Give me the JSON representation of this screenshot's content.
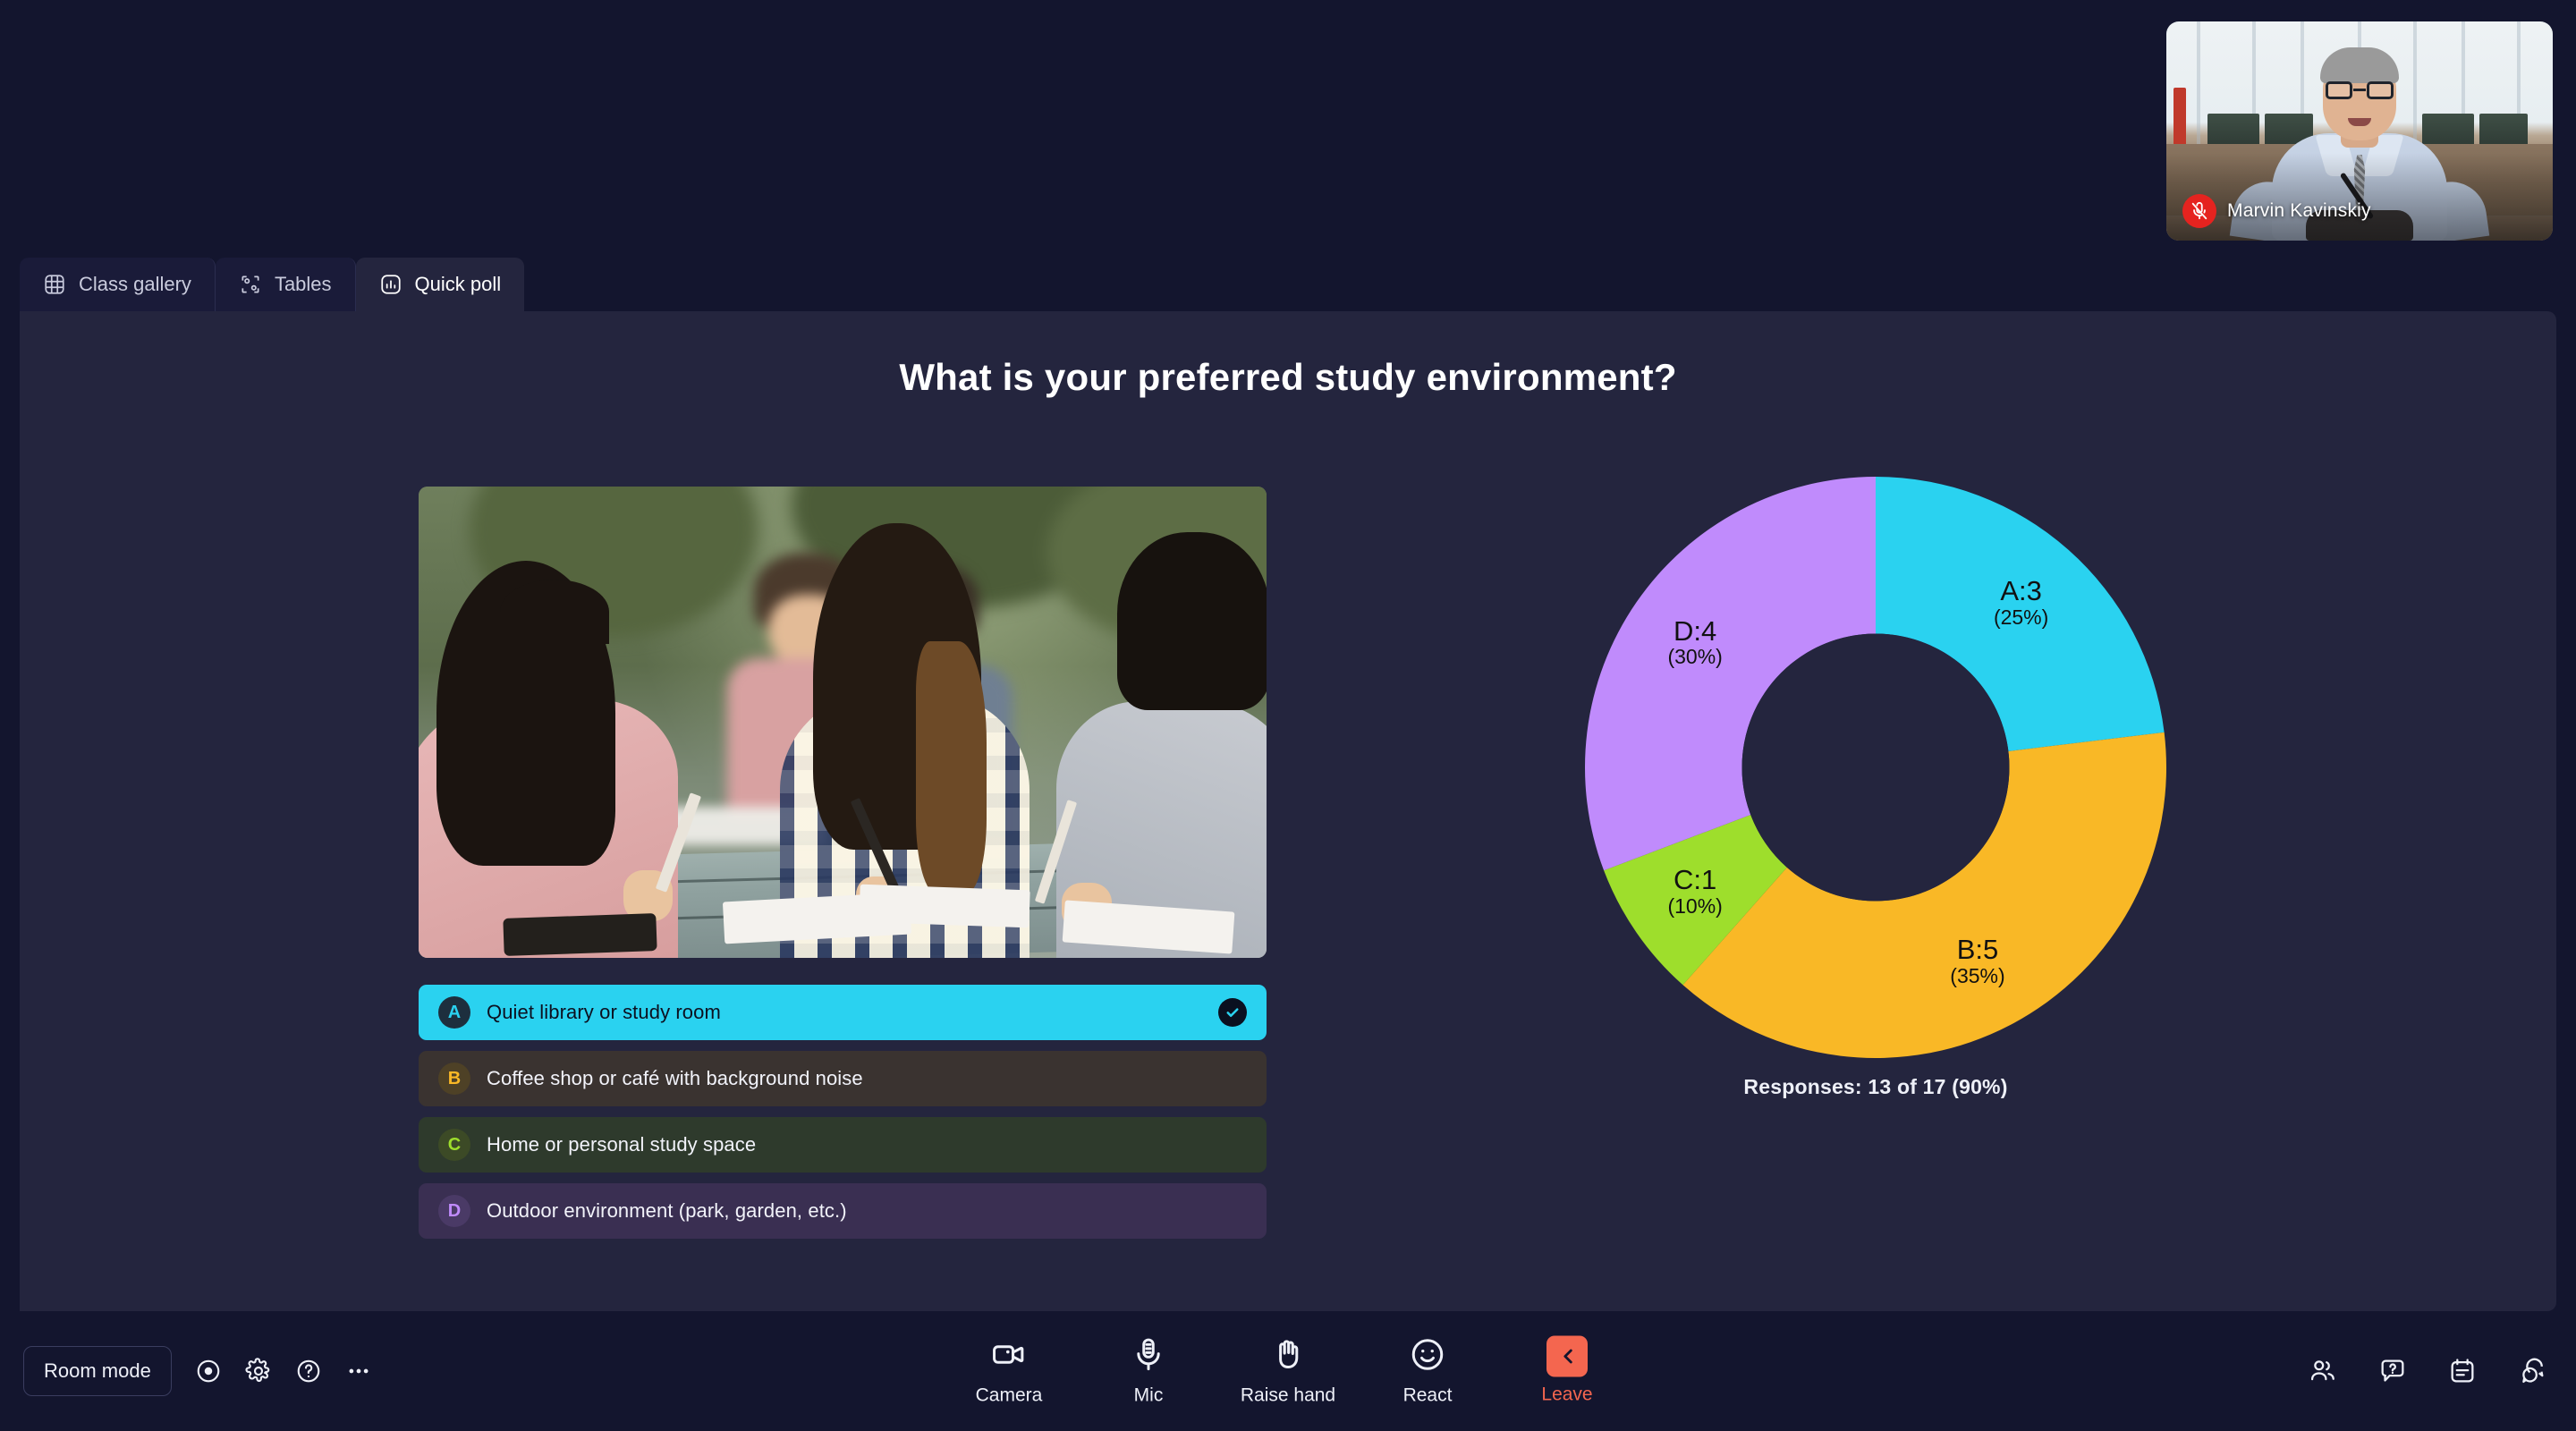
{
  "selfview": {
    "participant_name": "Marvin Kavinskiy",
    "mic_icon": "mic-muted-icon",
    "mic_muted": true
  },
  "tabs": [
    {
      "id": "class-gallery",
      "label": "Class gallery",
      "icon": "grid-icon",
      "active": false
    },
    {
      "id": "tables",
      "label": "Tables",
      "icon": "tables-icon",
      "active": false
    },
    {
      "id": "quick-poll",
      "label": "Quick poll",
      "icon": "bar-chart-icon",
      "active": true
    }
  ],
  "poll": {
    "title": "What is your preferred study environment?",
    "image_alt": "students-studying-outdoors-photo",
    "options": [
      {
        "key": "A",
        "label": "Quiet library or study room",
        "selected": true,
        "accent": "#2ad2f0",
        "row_bg": "#2ad2f0",
        "badge_bg": "#1d2f3e",
        "badge_fg": "#2ad2f0"
      },
      {
        "key": "B",
        "label": "Coffee shop or café with background noise",
        "selected": false,
        "accent": "#f9b826",
        "row_bg": "#3a3330",
        "badge_bg": "#4e4126",
        "badge_fg": "#f9b826"
      },
      {
        "key": "C",
        "label": "Home or personal study space",
        "selected": false,
        "accent": "#9ede2c",
        "row_bg": "#2e3a2c",
        "badge_bg": "#3c4a26",
        "badge_fg": "#9ede2c"
      },
      {
        "key": "D",
        "label": "Outdoor environment (park, garden, etc.)",
        "selected": false,
        "accent": "#c08bfc",
        "row_bg": "#3a2f52",
        "badge_bg": "#4a3a66",
        "badge_fg": "#c08bfc"
      }
    ],
    "selected_check_icon": "check-circle-icon",
    "responses_text": "Responses: 13 of 17 (90%)"
  },
  "chart_data": {
    "type": "pie",
    "variant": "donut",
    "title": "What is your preferred study environment?",
    "categories": [
      "A",
      "B",
      "C",
      "D"
    ],
    "values": [
      3,
      5,
      1,
      4
    ],
    "percentages": [
      25,
      35,
      10,
      30
    ],
    "labels": [
      "A:3",
      "B:5",
      "C:1",
      "D:4"
    ],
    "sublabels": [
      "(25%)",
      "(35%)",
      "(10%)",
      "(30%)"
    ],
    "colors": [
      "#2ad2f0",
      "#f9b826",
      "#9ede2c",
      "#c08bfc"
    ],
    "start_angle_deg": 0,
    "direction": "clockwise",
    "inner_radius_ratio": 0.46,
    "hole_color": "#24253e",
    "legend": "none",
    "grid": false,
    "responses_answered": 13,
    "responses_total": 17,
    "responses_percent": 90,
    "footer": "Responses: 13 of 17 (90%)"
  },
  "toolbar": {
    "room_mode_label": "Room mode",
    "left_icons": [
      {
        "id": "record",
        "icon": "record-circle-icon"
      },
      {
        "id": "settings",
        "icon": "gear-icon"
      },
      {
        "id": "help",
        "icon": "question-circle-icon"
      },
      {
        "id": "more",
        "icon": "ellipsis-icon"
      }
    ],
    "center_controls": [
      {
        "id": "camera",
        "label": "Camera",
        "icon": "camera-icon"
      },
      {
        "id": "mic",
        "label": "Mic",
        "icon": "microphone-icon"
      },
      {
        "id": "raise-hand",
        "label": "Raise hand",
        "icon": "raised-hand-icon"
      },
      {
        "id": "react",
        "label": "React",
        "icon": "smiley-icon"
      },
      {
        "id": "leave",
        "label": "Leave",
        "icon": "leave-arrow-icon"
      }
    ],
    "right_icons": [
      {
        "id": "people",
        "icon": "people-icon"
      },
      {
        "id": "qa",
        "icon": "question-bubble-icon"
      },
      {
        "id": "notes",
        "icon": "notes-icon"
      },
      {
        "id": "chat",
        "icon": "chat-bubbles-icon"
      }
    ]
  },
  "colors": {
    "page_bg": "#13152e",
    "panel_bg": "#24253e",
    "tab_inactive_bg": "#1a1b39",
    "leave_accent": "#f4664f",
    "mute_badge": "#e5231f"
  }
}
